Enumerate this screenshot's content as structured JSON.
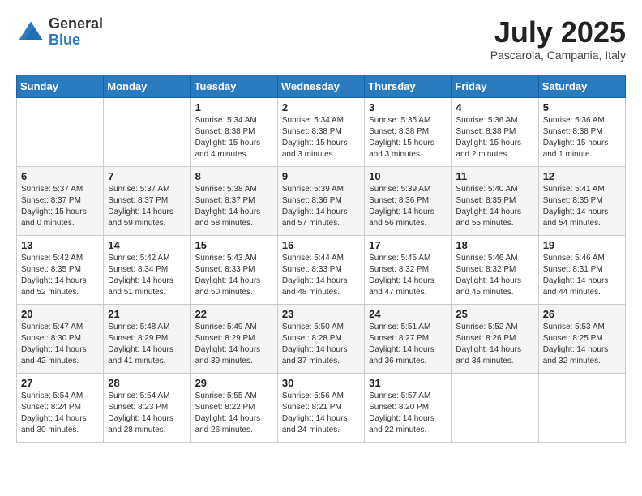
{
  "header": {
    "logo_general": "General",
    "logo_blue": "Blue",
    "month_title": "July 2025",
    "subtitle": "Pascarola, Campania, Italy"
  },
  "days_of_week": [
    "Sunday",
    "Monday",
    "Tuesday",
    "Wednesday",
    "Thursday",
    "Friday",
    "Saturday"
  ],
  "weeks": [
    [
      {
        "day": "",
        "info": ""
      },
      {
        "day": "",
        "info": ""
      },
      {
        "day": "1",
        "info": "Sunrise: 5:34 AM\nSunset: 8:38 PM\nDaylight: 15 hours and 4 minutes."
      },
      {
        "day": "2",
        "info": "Sunrise: 5:34 AM\nSunset: 8:38 PM\nDaylight: 15 hours and 3 minutes."
      },
      {
        "day": "3",
        "info": "Sunrise: 5:35 AM\nSunset: 8:38 PM\nDaylight: 15 hours and 3 minutes."
      },
      {
        "day": "4",
        "info": "Sunrise: 5:36 AM\nSunset: 8:38 PM\nDaylight: 15 hours and 2 minutes."
      },
      {
        "day": "5",
        "info": "Sunrise: 5:36 AM\nSunset: 8:38 PM\nDaylight: 15 hours and 1 minute."
      }
    ],
    [
      {
        "day": "6",
        "info": "Sunrise: 5:37 AM\nSunset: 8:37 PM\nDaylight: 15 hours and 0 minutes."
      },
      {
        "day": "7",
        "info": "Sunrise: 5:37 AM\nSunset: 8:37 PM\nDaylight: 14 hours and 59 minutes."
      },
      {
        "day": "8",
        "info": "Sunrise: 5:38 AM\nSunset: 8:37 PM\nDaylight: 14 hours and 58 minutes."
      },
      {
        "day": "9",
        "info": "Sunrise: 5:39 AM\nSunset: 8:36 PM\nDaylight: 14 hours and 57 minutes."
      },
      {
        "day": "10",
        "info": "Sunrise: 5:39 AM\nSunset: 8:36 PM\nDaylight: 14 hours and 56 minutes."
      },
      {
        "day": "11",
        "info": "Sunrise: 5:40 AM\nSunset: 8:35 PM\nDaylight: 14 hours and 55 minutes."
      },
      {
        "day": "12",
        "info": "Sunrise: 5:41 AM\nSunset: 8:35 PM\nDaylight: 14 hours and 54 minutes."
      }
    ],
    [
      {
        "day": "13",
        "info": "Sunrise: 5:42 AM\nSunset: 8:35 PM\nDaylight: 14 hours and 52 minutes."
      },
      {
        "day": "14",
        "info": "Sunrise: 5:42 AM\nSunset: 8:34 PM\nDaylight: 14 hours and 51 minutes."
      },
      {
        "day": "15",
        "info": "Sunrise: 5:43 AM\nSunset: 8:33 PM\nDaylight: 14 hours and 50 minutes."
      },
      {
        "day": "16",
        "info": "Sunrise: 5:44 AM\nSunset: 8:33 PM\nDaylight: 14 hours and 48 minutes."
      },
      {
        "day": "17",
        "info": "Sunrise: 5:45 AM\nSunset: 8:32 PM\nDaylight: 14 hours and 47 minutes."
      },
      {
        "day": "18",
        "info": "Sunrise: 5:46 AM\nSunset: 8:32 PM\nDaylight: 14 hours and 45 minutes."
      },
      {
        "day": "19",
        "info": "Sunrise: 5:46 AM\nSunset: 8:31 PM\nDaylight: 14 hours and 44 minutes."
      }
    ],
    [
      {
        "day": "20",
        "info": "Sunrise: 5:47 AM\nSunset: 8:30 PM\nDaylight: 14 hours and 42 minutes."
      },
      {
        "day": "21",
        "info": "Sunrise: 5:48 AM\nSunset: 8:29 PM\nDaylight: 14 hours and 41 minutes."
      },
      {
        "day": "22",
        "info": "Sunrise: 5:49 AM\nSunset: 8:29 PM\nDaylight: 14 hours and 39 minutes."
      },
      {
        "day": "23",
        "info": "Sunrise: 5:50 AM\nSunset: 8:28 PM\nDaylight: 14 hours and 37 minutes."
      },
      {
        "day": "24",
        "info": "Sunrise: 5:51 AM\nSunset: 8:27 PM\nDaylight: 14 hours and 36 minutes."
      },
      {
        "day": "25",
        "info": "Sunrise: 5:52 AM\nSunset: 8:26 PM\nDaylight: 14 hours and 34 minutes."
      },
      {
        "day": "26",
        "info": "Sunrise: 5:53 AM\nSunset: 8:25 PM\nDaylight: 14 hours and 32 minutes."
      }
    ],
    [
      {
        "day": "27",
        "info": "Sunrise: 5:54 AM\nSunset: 8:24 PM\nDaylight: 14 hours and 30 minutes."
      },
      {
        "day": "28",
        "info": "Sunrise: 5:54 AM\nSunset: 8:23 PM\nDaylight: 14 hours and 28 minutes."
      },
      {
        "day": "29",
        "info": "Sunrise: 5:55 AM\nSunset: 8:22 PM\nDaylight: 14 hours and 26 minutes."
      },
      {
        "day": "30",
        "info": "Sunrise: 5:56 AM\nSunset: 8:21 PM\nDaylight: 14 hours and 24 minutes."
      },
      {
        "day": "31",
        "info": "Sunrise: 5:57 AM\nSunset: 8:20 PM\nDaylight: 14 hours and 22 minutes."
      },
      {
        "day": "",
        "info": ""
      },
      {
        "day": "",
        "info": ""
      }
    ]
  ]
}
